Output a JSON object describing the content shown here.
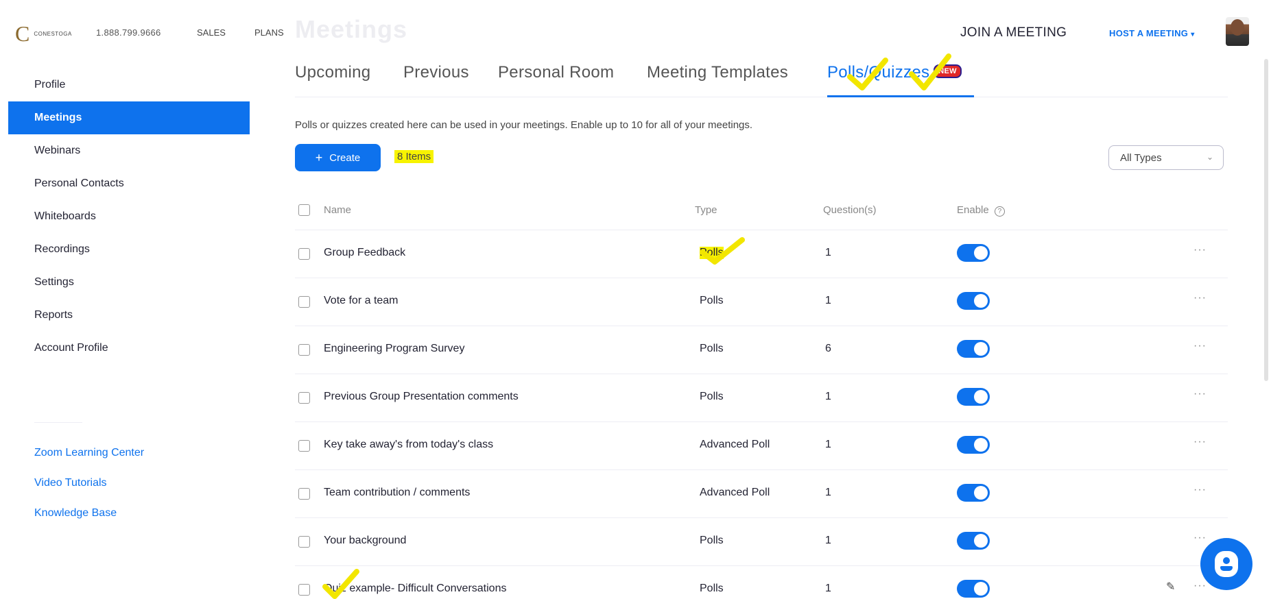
{
  "header": {
    "logo_mark": "C",
    "logo_line1": "CONESTOGA",
    "phone": "1.888.799.9666",
    "sales": "SALES",
    "plans": "PLANS",
    "ghost_title": "Meetings",
    "join": "JOIN A MEETING",
    "host": "HOST A MEETING"
  },
  "sidebar": {
    "items": [
      {
        "label": "Profile"
      },
      {
        "label": "Meetings",
        "active": true
      },
      {
        "label": "Webinars"
      },
      {
        "label": "Personal Contacts"
      },
      {
        "label": "Whiteboards"
      },
      {
        "label": "Recordings"
      },
      {
        "label": "Settings"
      },
      {
        "label": "Reports"
      },
      {
        "label": "Account Profile"
      }
    ],
    "links": [
      "Zoom Learning Center",
      "Video Tutorials",
      "Knowledge Base"
    ]
  },
  "tabs": {
    "items": [
      "Upcoming",
      "Previous",
      "Personal Room",
      "Meeting Templates",
      "Polls/Quizzes"
    ],
    "active": "Polls/Quizzes",
    "new_badge": "NEW"
  },
  "description": "Polls or quizzes created here can be used in your meetings. Enable up to 10 for all of your meetings.",
  "toolbar": {
    "create_label": "Create",
    "items_count": "8 Items",
    "type_filter": "All Types"
  },
  "table": {
    "columns": [
      "Name",
      "Type",
      "Question(s)",
      "Enable"
    ],
    "rows": [
      {
        "name": "Group Feedback",
        "type": "Polls",
        "questions": "1",
        "enabled": true
      },
      {
        "name": "Vote for a team",
        "type": "Polls",
        "questions": "1",
        "enabled": true
      },
      {
        "name": "Engineering Program Survey",
        "type": "Polls",
        "questions": "6",
        "enabled": true
      },
      {
        "name": "Previous Group Presentation comments",
        "type": "Polls",
        "questions": "1",
        "enabled": true
      },
      {
        "name": "Key take away's from today's class",
        "type": "Advanced Poll",
        "questions": "1",
        "enabled": true
      },
      {
        "name": "Team contribution / comments",
        "type": "Advanced Poll",
        "questions": "1",
        "enabled": true
      },
      {
        "name": "Your background",
        "type": "Polls",
        "questions": "1",
        "enabled": true
      },
      {
        "name": "Quiz example- Difficult Conversations",
        "type": "Polls",
        "questions": "1",
        "enabled": true
      }
    ],
    "more_label": "···"
  },
  "colors": {
    "accent": "#0e72ed",
    "highlight": "#f7f300",
    "badge": "#e02828"
  }
}
